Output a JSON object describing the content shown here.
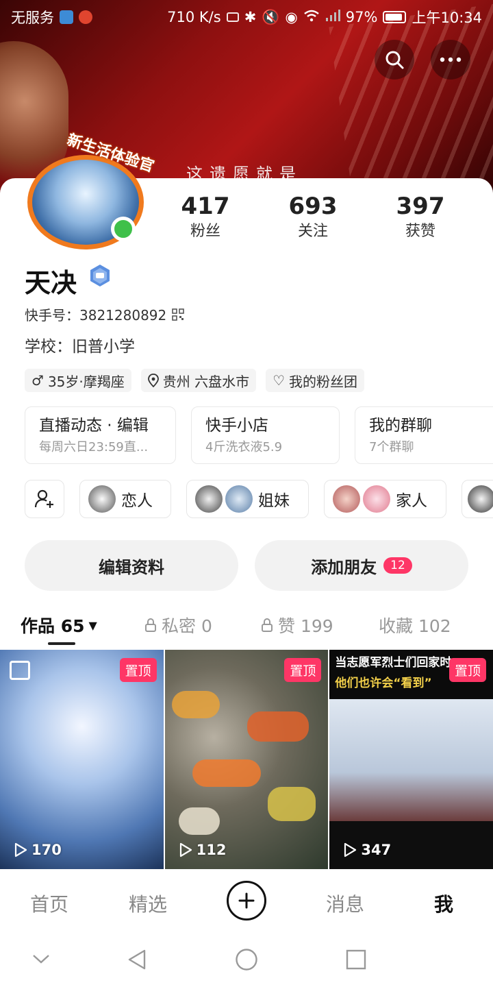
{
  "status_bar": {
    "carrier": "无服务",
    "speed": "710 K/s",
    "battery": "97%",
    "time": "上午10:34"
  },
  "banner": {
    "overlay_text": "这遗愿就是"
  },
  "avatar": {
    "badge_text": "新生活体验官"
  },
  "stats": [
    {
      "value": "417",
      "label": "粉丝"
    },
    {
      "value": "693",
      "label": "关注"
    },
    {
      "value": "397",
      "label": "获赞"
    }
  ],
  "profile": {
    "name": "天决",
    "kuaishou_id": "快手号：3821280892",
    "school": "学校：旧普小学"
  },
  "tags": [
    {
      "icon": "male-icon",
      "text": "35岁·摩羯座"
    },
    {
      "icon": "location-icon",
      "text": "贵州 六盘水市"
    },
    {
      "icon": "heart-icon",
      "text": "我的粉丝团"
    }
  ],
  "features": [
    {
      "title": "直播动态 · 编辑",
      "sub": "每周六日23:59直..."
    },
    {
      "title": "快手小店",
      "sub": "4斤洗衣液5.9"
    },
    {
      "title": "我的群聊",
      "sub": "7个群聊"
    }
  ],
  "relations": [
    {
      "label": "恋人"
    },
    {
      "label": "姐妹"
    },
    {
      "label": "家人"
    }
  ],
  "buttons": {
    "edit": "编辑资料",
    "add_friend": "添加朋友",
    "add_friend_badge": "12"
  },
  "tabs": [
    {
      "label": "作品 65"
    },
    {
      "label": "私密 0"
    },
    {
      "label": "赞 199"
    },
    {
      "label": "收藏 102"
    }
  ],
  "videos": [
    {
      "pinned": "置顶",
      "plays": "170"
    },
    {
      "pinned": "置顶",
      "plays": "112"
    },
    {
      "pinned": "置顶",
      "plays": "347",
      "caption1": "当志愿军烈士们回家时",
      "caption2": "他们也许会“看到”"
    }
  ],
  "bottom_nav": [
    {
      "label": "首页"
    },
    {
      "label": "精选"
    },
    {
      "label": "消息"
    },
    {
      "label": "我"
    }
  ],
  "colors": {
    "accent": "#fe3666",
    "online": "#3fc04a",
    "avatar_ring": "#f07a1e",
    "banner": "#a01212"
  }
}
